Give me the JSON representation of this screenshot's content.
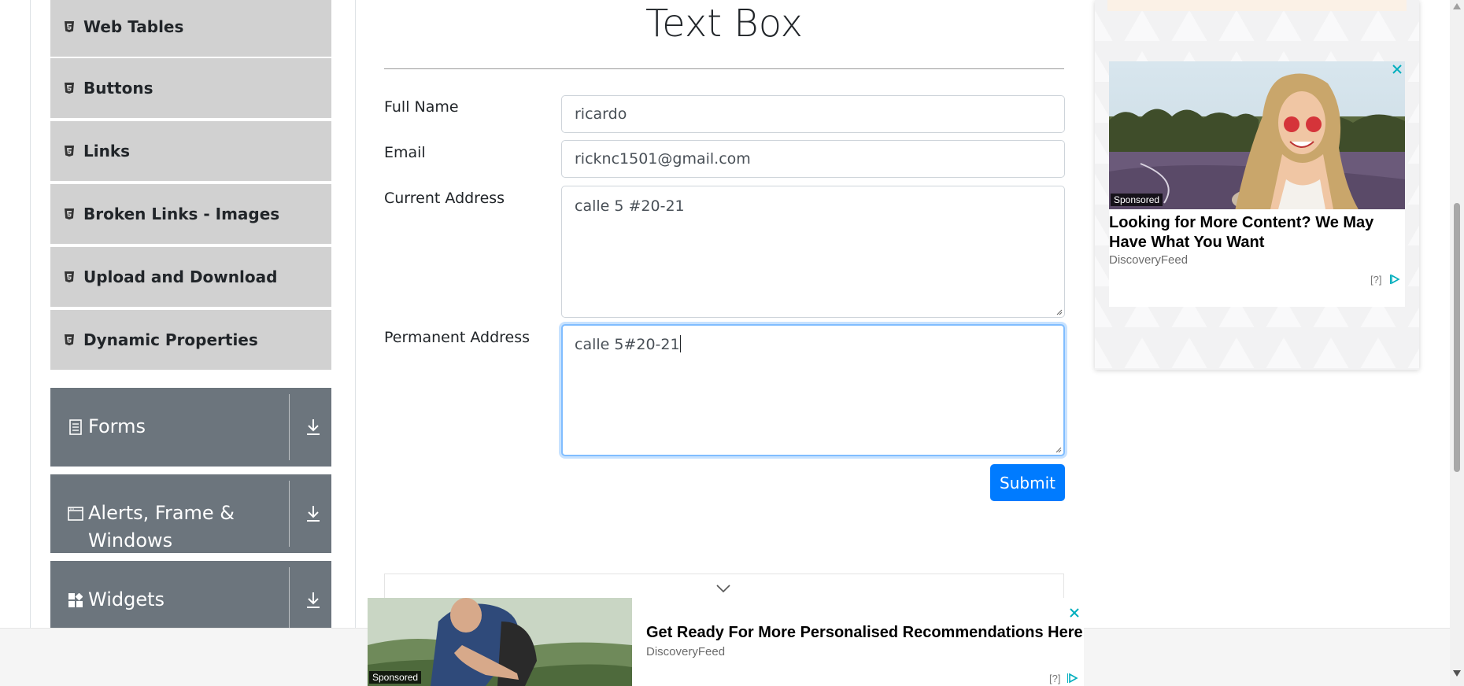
{
  "sidebar": {
    "elements_items": [
      {
        "label": "Web Tables",
        "icon": "html5-icon"
      },
      {
        "label": "Buttons",
        "icon": "html5-icon"
      },
      {
        "label": "Links",
        "icon": "html5-icon"
      },
      {
        "label": "Broken Links - Images",
        "icon": "html5-icon"
      },
      {
        "label": "Upload and Download",
        "icon": "html5-icon"
      },
      {
        "label": "Dynamic Properties",
        "icon": "html5-icon"
      }
    ],
    "groups": [
      {
        "label": "Forms",
        "icon": "document-icon"
      },
      {
        "label_line1": "Alerts, Frame &",
        "label_line2": "Windows",
        "icon": "window-icon"
      },
      {
        "label": "Widgets",
        "icon": "widgets-icon"
      }
    ]
  },
  "main": {
    "title": "Text Box",
    "fields": {
      "full_name": {
        "label": "Full Name",
        "value": "ricardo"
      },
      "email": {
        "label": "Email",
        "value": "ricknc1501@gmail.com"
      },
      "current_address": {
        "label": "Current Address",
        "value": "calle 5 #20-21"
      },
      "permanent_address": {
        "label": "Permanent Address",
        "value": "calle 5#20-21"
      }
    },
    "submit_label": "Submit"
  },
  "right_ad": {
    "sponsored": "Sponsored",
    "headline": "Looking for More Content? We May Have What You Want",
    "source": "DiscoveryFeed",
    "info": "[?]"
  },
  "bottom_ad": {
    "sponsored": "Sponsored",
    "headline": "Get Ready For More Personalised Recommendations Here",
    "source": "DiscoveryFeed",
    "info": "[?]"
  },
  "colors": {
    "primary": "#007bff",
    "sidebar_item_bg": "#d1d1d1",
    "group_header_bg": "#6c757d",
    "ad_close": "#00aebd"
  }
}
